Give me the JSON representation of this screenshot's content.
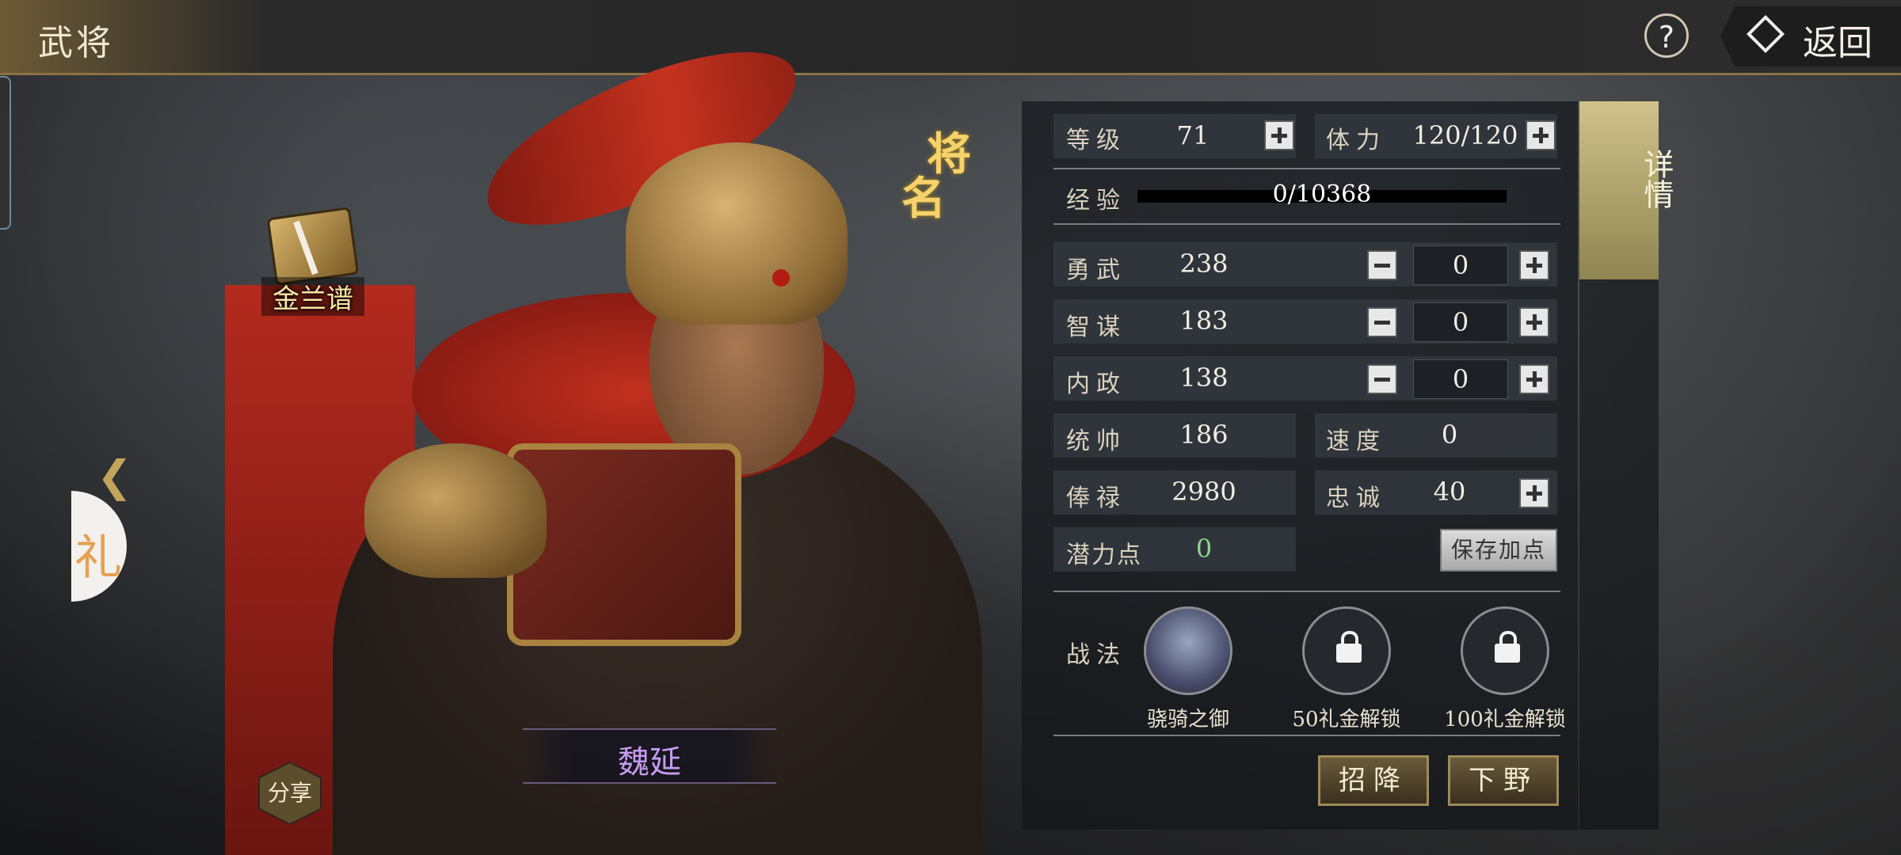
{
  "header": {
    "title": "武将",
    "help_label": "?",
    "back_label": "返回"
  },
  "hero": {
    "name": "魏延",
    "badge_label": "金兰谱",
    "name_tag": [
      "将",
      "名"
    ],
    "share_label": "分享",
    "gift_glyph": "礼"
  },
  "side_tab": {
    "label": "详情"
  },
  "stats": {
    "level": {
      "label": "等级",
      "value": "71"
    },
    "stamina": {
      "label": "体力",
      "value": "120/120"
    },
    "exp": {
      "label": "经验",
      "value": "0/10368",
      "progress": 0
    },
    "might": {
      "label": "勇武",
      "value": "238",
      "alloc": "0"
    },
    "intellect": {
      "label": "智谋",
      "value": "183",
      "alloc": "0"
    },
    "politics": {
      "label": "内政",
      "value": "138",
      "alloc": "0"
    },
    "command": {
      "label": "统帅",
      "value": "186"
    },
    "speed": {
      "label": "速度",
      "value": "0"
    },
    "salary": {
      "label": "俸禄",
      "value": "2980"
    },
    "loyalty": {
      "label": "忠诚",
      "value": "40"
    },
    "potential": {
      "label": "潜力点",
      "value": "0"
    },
    "save_label": "保存加点"
  },
  "tactics": {
    "label": "战法",
    "skills": [
      {
        "caption": "骁骑之御"
      },
      {
        "caption": "50礼金解锁"
      },
      {
        "caption": "100礼金解锁"
      }
    ]
  },
  "actions": {
    "recruit": "招降",
    "dismiss": "下野"
  },
  "colors": {
    "accent_gold": "#8b7443",
    "name_purple": "#c79cf1",
    "potential_green": "#8fd18a"
  }
}
